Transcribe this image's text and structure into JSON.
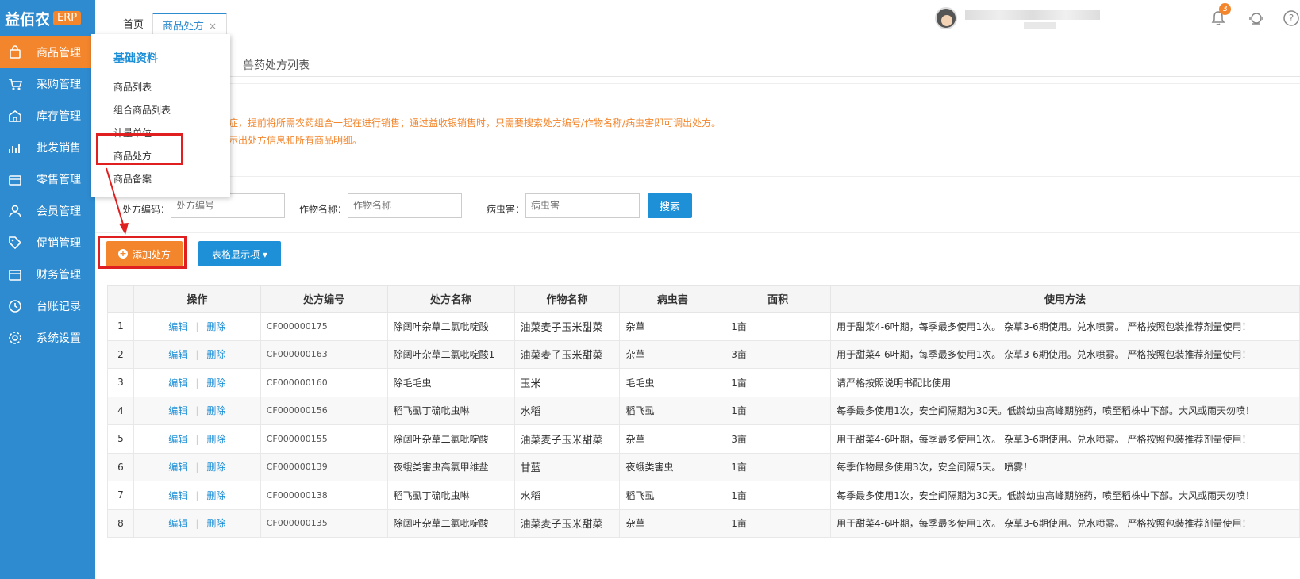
{
  "brand": {
    "name": "益佰农",
    "badge": "ERP",
    "accent": "#f3862c",
    "sidebar_bg": "#2e8bd0"
  },
  "sidebar": {
    "items": [
      {
        "label": "商品管理",
        "icon": "shopping-bag-icon",
        "active": true
      },
      {
        "label": "采购管理",
        "icon": "cart-icon"
      },
      {
        "label": "库存管理",
        "icon": "warehouse-icon"
      },
      {
        "label": "批发销售",
        "icon": "chart-icon"
      },
      {
        "label": "零售管理",
        "icon": "store-icon"
      },
      {
        "label": "会员管理",
        "icon": "user-icon"
      },
      {
        "label": "促销管理",
        "icon": "tag-icon"
      },
      {
        "label": "财务管理",
        "icon": "finance-icon"
      },
      {
        "label": "台账记录",
        "icon": "clock-icon"
      },
      {
        "label": "系统设置",
        "icon": "gear-icon"
      }
    ]
  },
  "tabs": {
    "home": "首页",
    "current": "商品处方",
    "close": "×"
  },
  "topbar": {
    "notifications": "3"
  },
  "submenu": {
    "title": "基础资料",
    "items": [
      "商品列表",
      "组合商品列表",
      "计量单位",
      "商品处方",
      "商品备案"
    ]
  },
  "subnav": {
    "title": "兽药处方列表"
  },
  "tips": {
    "line1": "症，提前将所需农药组合一起在进行销售；通过益收银销售时，只需要搜索处方编号/作物名称/病虫害即可调出处方。",
    "line2": "示出处方信息和所有商品明细。"
  },
  "search": {
    "code_label": "处方编码：",
    "code_placeholder": "处方编号",
    "crop_label": "作物名称：",
    "crop_placeholder": "作物名称",
    "pest_label": "病虫害：",
    "pest_placeholder": "病虫害",
    "button": "搜索"
  },
  "actions": {
    "add": "添加处方",
    "columns": "表格显示项 ▾"
  },
  "table": {
    "headers": [
      "",
      "操作",
      "处方编号",
      "处方名称",
      "作物名称",
      "病虫害",
      "面积",
      "使用方法"
    ],
    "edit_label": "编辑",
    "delete_label": "删除",
    "sep": "|",
    "rows": [
      {
        "no": "1",
        "code": "CF000000175",
        "name": "除阔叶杂草二氯吡啶酸",
        "crop": "油菜麦子玉米甜菜",
        "pest": "杂草",
        "area": "1亩",
        "usage": "用于甜菜4-6叶期，每季最多使用1次。 杂草3-6期使用。兑水喷雾。 严格按照包装推荐剂量使用！"
      },
      {
        "no": "2",
        "code": "CF000000163",
        "name": "除阔叶杂草二氯吡啶酸1",
        "crop": "油菜麦子玉米甜菜",
        "pest": "杂草",
        "area": "3亩",
        "usage": "用于甜菜4-6叶期，每季最多使用1次。 杂草3-6期使用。兑水喷雾。 严格按照包装推荐剂量使用！"
      },
      {
        "no": "3",
        "code": "CF000000160",
        "name": "除毛毛虫",
        "crop": "玉米",
        "pest": "毛毛虫",
        "area": "1亩",
        "usage": "请严格按照说明书配比使用"
      },
      {
        "no": "4",
        "code": "CF000000156",
        "name": "稻飞虱丁硫吡虫啉",
        "crop": "水稻",
        "pest": "稻飞虱",
        "area": "1亩",
        "usage": "每季最多使用1次，安全间隔期为30天。低龄幼虫高峰期施药，喷至稻株中下部。大风或雨天勿喷！"
      },
      {
        "no": "5",
        "code": "CF000000155",
        "name": "除阔叶杂草二氯吡啶酸",
        "crop": "油菜麦子玉米甜菜",
        "pest": "杂草",
        "area": "3亩",
        "usage": "用于甜菜4-6叶期，每季最多使用1次。 杂草3-6期使用。兑水喷雾。 严格按照包装推荐剂量使用！"
      },
      {
        "no": "6",
        "code": "CF000000139",
        "name": "夜蛾类害虫高氯甲维盐",
        "crop": "甘蓝",
        "pest": "夜蛾类害虫",
        "area": "1亩",
        "usage": "每季作物最多使用3次，安全间隔5天。 喷雾！"
      },
      {
        "no": "7",
        "code": "CF000000138",
        "name": "稻飞虱丁硫吡虫啉",
        "crop": "水稻",
        "pest": "稻飞虱",
        "area": "1亩",
        "usage": "每季最多使用1次，安全间隔期为30天。低龄幼虫高峰期施药，喷至稻株中下部。大风或雨天勿喷！"
      },
      {
        "no": "8",
        "code": "CF000000135",
        "name": "除阔叶杂草二氯吡啶酸",
        "crop": "油菜麦子玉米甜菜",
        "pest": "杂草",
        "area": "1亩",
        "usage": "用于甜菜4-6叶期，每季最多使用1次。 杂草3-6期使用。兑水喷雾。 严格按照包装推荐剂量使用！"
      }
    ]
  },
  "annotation_color": "#e02020"
}
